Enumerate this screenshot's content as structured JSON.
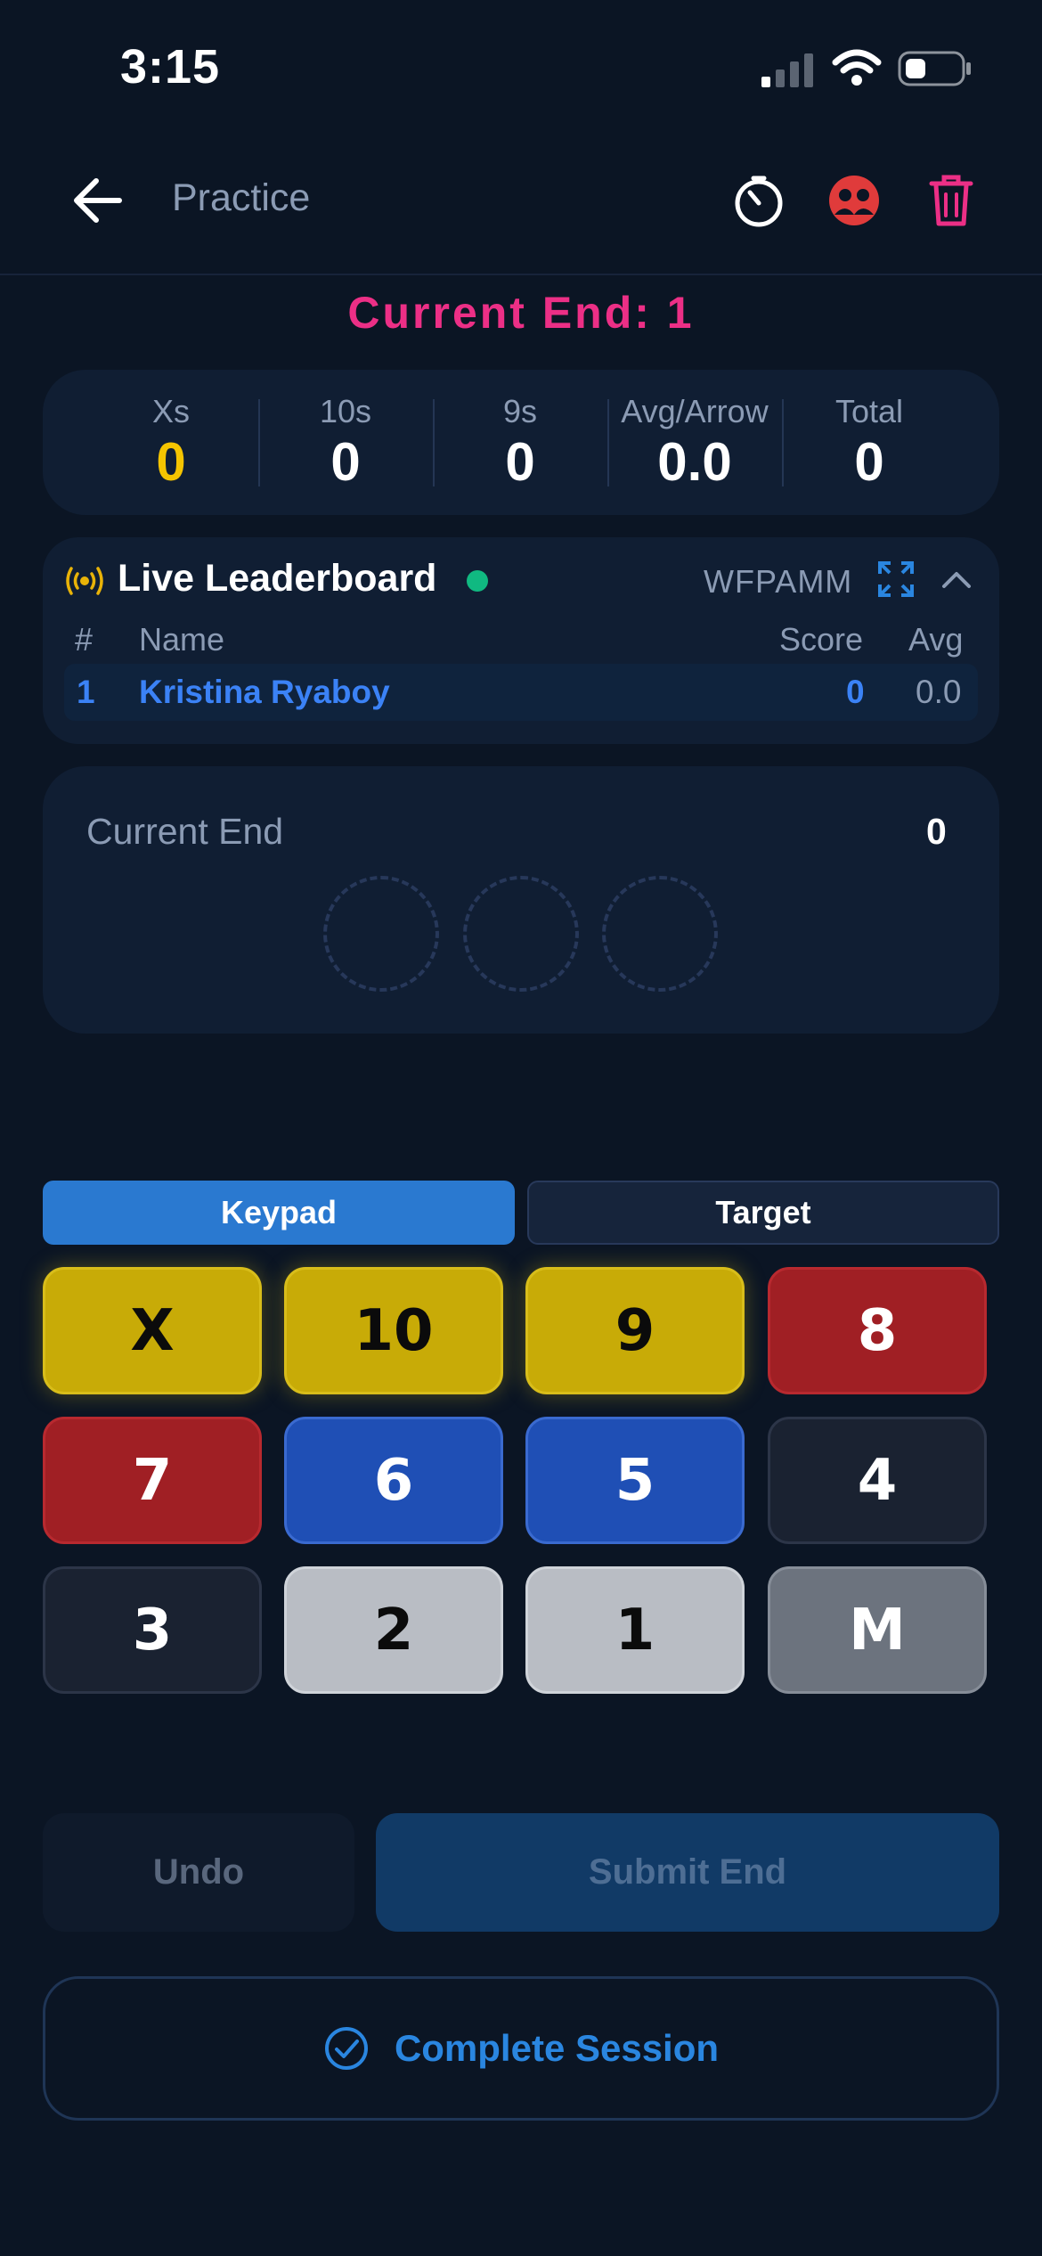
{
  "status_bar": {
    "time": "3:15"
  },
  "header": {
    "title": "Practice",
    "icons": [
      "back-arrow-icon",
      "stopwatch-icon",
      "group-icon",
      "trash-icon"
    ]
  },
  "current_end_title": "Current End: 1",
  "stats": [
    {
      "label": "Xs",
      "value": "0",
      "color": "#f5c400"
    },
    {
      "label": "10s",
      "value": "0"
    },
    {
      "label": "9s",
      "value": "0"
    },
    {
      "label": "Avg/Arrow",
      "value": "0.0"
    },
    {
      "label": "Total",
      "value": "0"
    }
  ],
  "leaderboard": {
    "title": "Live Leaderboard",
    "code": "WFPAMM",
    "columns": {
      "rank": "#",
      "name": "Name",
      "score": "Score",
      "avg": "Avg"
    },
    "rows": [
      {
        "rank": "1",
        "name": "Kristina Ryaboy",
        "score": "0",
        "avg": "0.0"
      }
    ]
  },
  "current_end": {
    "label": "Current End",
    "total": "0",
    "empty_slots": 3
  },
  "tabs": {
    "keypad": "Keypad",
    "target": "Target",
    "active": "keypad"
  },
  "keys": [
    "X",
    "10",
    "9",
    "8",
    "7",
    "6",
    "5",
    "4",
    "3",
    "2",
    "1",
    "M"
  ],
  "actions": {
    "undo": "Undo",
    "submit": "Submit End",
    "complete": "Complete Session"
  },
  "colors": {
    "accent_pink": "#ec2f86",
    "accent_blue": "#2a79d0",
    "gold": "#c8ab07",
    "live_green": "#10b981"
  }
}
